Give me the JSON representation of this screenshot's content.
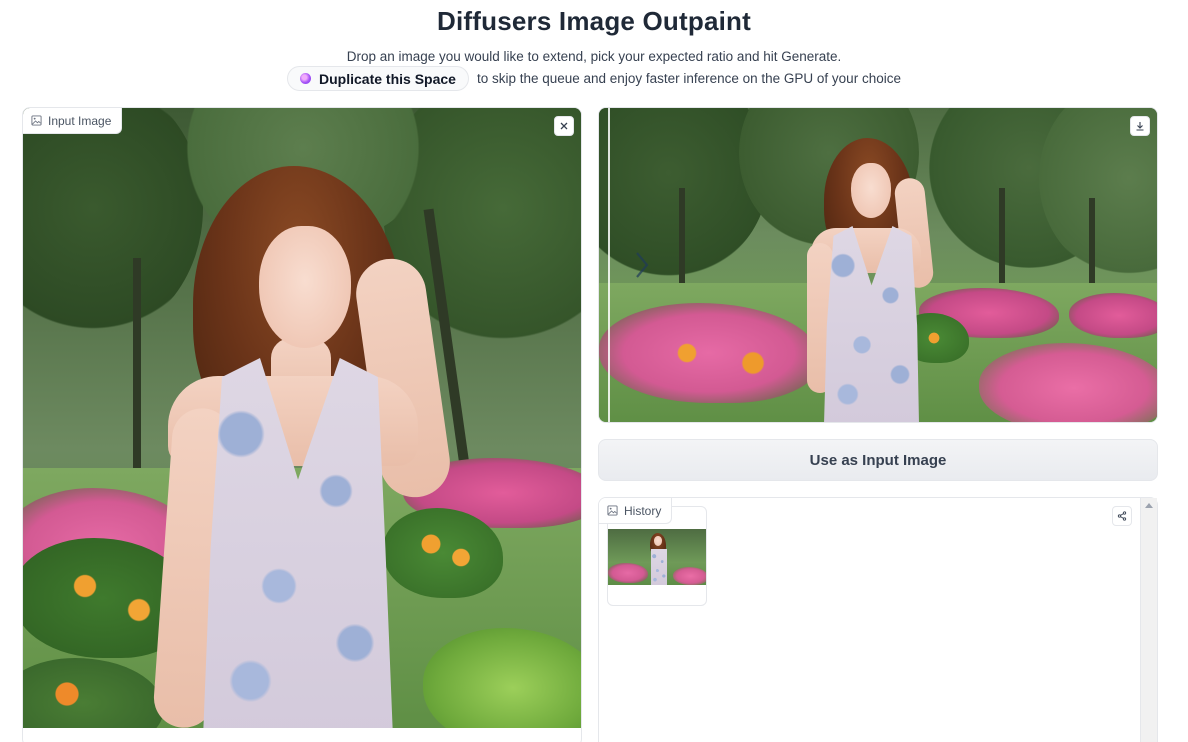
{
  "header": {
    "title": "Diffusers Image Outpaint",
    "subtitle": "Drop an image you would like to extend, pick your expected ratio and hit Generate.",
    "duplicate_label": "Duplicate this Space",
    "duplicate_suffix": "to skip the queue and enjoy faster inference on the GPU of your choice"
  },
  "input_panel": {
    "label": "Input Image",
    "icons": {
      "tag": "image-icon",
      "clear": "close-icon"
    }
  },
  "output_panel": {
    "icons": {
      "download": "download-icon",
      "slider": "chevron-right-icon"
    }
  },
  "actions": {
    "use_as_input_label": "Use as Input Image"
  },
  "history_panel": {
    "label": "History",
    "icons": {
      "tag": "image-icon",
      "share": "share-icon"
    }
  },
  "colors": {
    "accent_purple": "#a855f7",
    "border": "#e5e7eb",
    "button_bg": "#eceef1",
    "text": "#1f2937"
  }
}
